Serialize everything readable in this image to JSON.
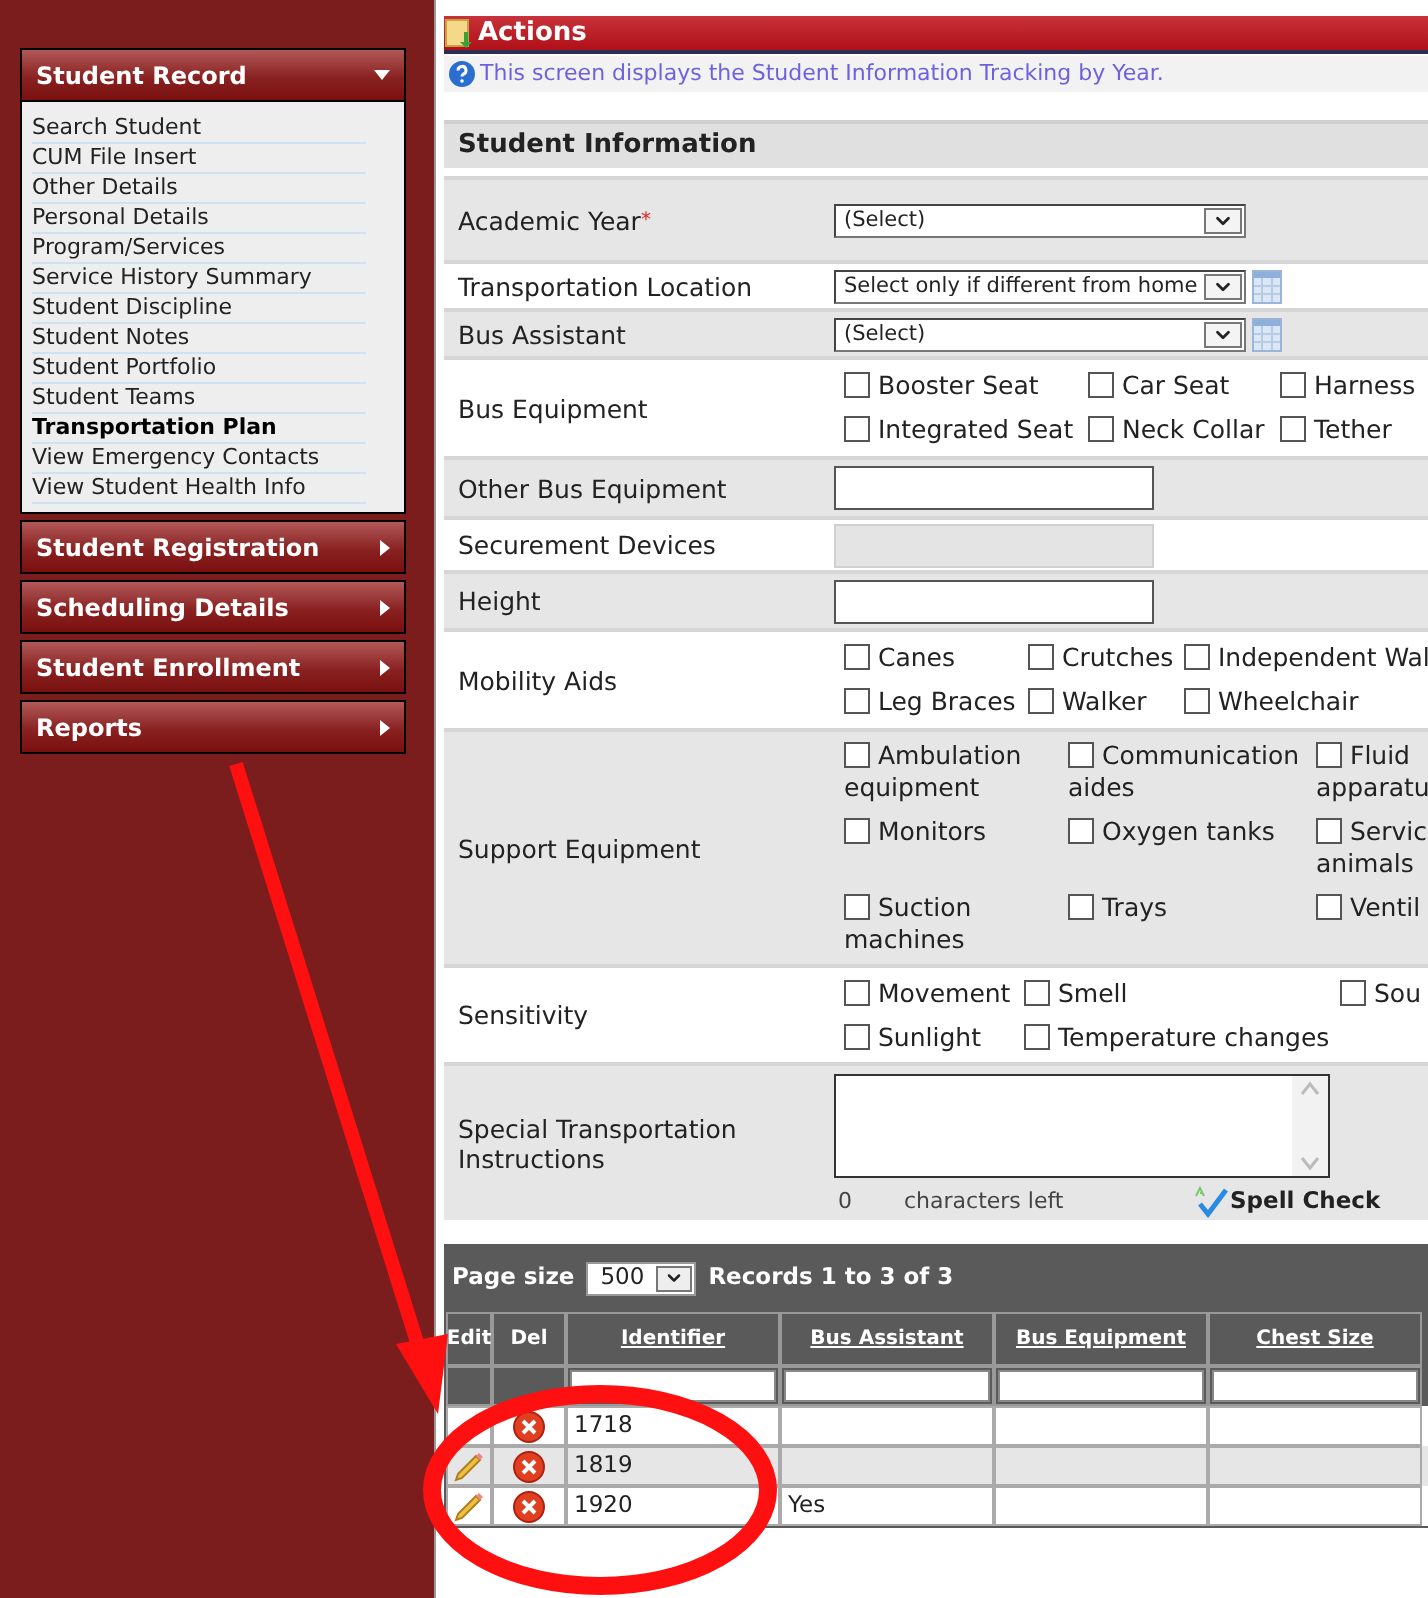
{
  "sidebar": {
    "sections": [
      {
        "title": "Student Record",
        "expanded": true,
        "items": [
          {
            "label": "Search Student",
            "selected": false
          },
          {
            "label": "CUM File Insert",
            "selected": false
          },
          {
            "label": "Other Details",
            "selected": false
          },
          {
            "label": "Personal Details",
            "selected": false
          },
          {
            "label": "Program/Services",
            "selected": false
          },
          {
            "label": "Service History Summary",
            "selected": false
          },
          {
            "label": "Student Discipline",
            "selected": false
          },
          {
            "label": "Student Notes",
            "selected": false
          },
          {
            "label": "Student Portfolio",
            "selected": false
          },
          {
            "label": "Student Teams",
            "selected": false
          },
          {
            "label": "Transportation Plan",
            "selected": true
          },
          {
            "label": "View Emergency Contacts",
            "selected": false
          },
          {
            "label": "View Student Health Info",
            "selected": false
          }
        ]
      },
      {
        "title": "Student Registration",
        "expanded": false
      },
      {
        "title": "Scheduling Details",
        "expanded": false
      },
      {
        "title": "Student Enrollment",
        "expanded": false
      },
      {
        "title": "Reports",
        "expanded": false
      }
    ]
  },
  "actions": {
    "title": "Actions",
    "help_text": "This screen displays the Student Information Tracking by Year."
  },
  "form": {
    "title": "Student Information",
    "rows": [
      {
        "label": "Academic Year",
        "required_mark": "*",
        "kind": "select",
        "value": "(Select)"
      },
      {
        "label": "Transportation Location",
        "kind": "select",
        "value": "Select only if different from home",
        "lookup": true
      },
      {
        "label": "Bus Assistant",
        "kind": "select",
        "value": "(Select)",
        "lookup": true
      },
      {
        "label": "Bus Equipment",
        "kind": "checkboxes",
        "options": [
          {
            "label": "Booster Seat",
            "checked": false
          },
          {
            "label": "Car Seat",
            "checked": false
          },
          {
            "label": "Harness",
            "checked": false
          },
          {
            "label": "Integrated Seat",
            "checked": false
          },
          {
            "label": "Neck Collar",
            "checked": false
          },
          {
            "label": "Tether",
            "checked": false
          }
        ]
      },
      {
        "label": "Other Bus Equipment",
        "kind": "text",
        "disabled": false
      },
      {
        "label": "Securement Devices",
        "kind": "text",
        "disabled": true
      },
      {
        "label": "Height",
        "kind": "text",
        "disabled": false
      },
      {
        "label": "Mobility Aids",
        "kind": "checkboxes",
        "options": [
          {
            "label": "Canes",
            "checked": false
          },
          {
            "label": "Crutches",
            "checked": false
          },
          {
            "label": "Independent Wal",
            "checked": false
          },
          {
            "label": "Leg Braces",
            "checked": false
          },
          {
            "label": "Walker",
            "checked": false
          },
          {
            "label": "Wheelchair",
            "checked": false
          }
        ]
      },
      {
        "label": "Support Equipment",
        "kind": "checkboxes",
        "options": [
          {
            "label": "Ambulation equipment",
            "checked": false
          },
          {
            "label": "Communication aides",
            "checked": false
          },
          {
            "label": "Fluid apparatu",
            "checked": false
          },
          {
            "label": "Monitors",
            "checked": false
          },
          {
            "label": "Oxygen tanks",
            "checked": false
          },
          {
            "label": "Servic animals",
            "checked": false
          },
          {
            "label": "Suction machines",
            "checked": false
          },
          {
            "label": "Trays",
            "checked": false
          },
          {
            "label": "Ventil",
            "checked": false
          }
        ]
      },
      {
        "label": "Sensitivity",
        "kind": "checkboxes",
        "options": [
          {
            "label": "Movement",
            "checked": false
          },
          {
            "label": "Smell",
            "checked": false
          },
          {
            "label": "Sou",
            "checked": false
          },
          {
            "label": "Sunlight",
            "checked": false
          },
          {
            "label": "Temperature changes",
            "checked": false
          }
        ]
      },
      {
        "label": "Special Transportation Instructions",
        "kind": "textarea",
        "count": "0",
        "count_label": "characters left",
        "spell_check": "Spell Check"
      }
    ]
  },
  "grid": {
    "page_size_label": "Page size",
    "page_size": "500",
    "records": "Records 1 to 3 of 3",
    "columns": [
      {
        "label": "Edit",
        "sortable": false,
        "filter": false
      },
      {
        "label": "Del",
        "sortable": false,
        "filter": false
      },
      {
        "label": "Identifier",
        "sortable": true,
        "filter": true
      },
      {
        "label": "Bus Assistant",
        "sortable": true,
        "filter": true
      },
      {
        "label": "Bus Equipment",
        "sortable": true,
        "filter": true
      },
      {
        "label": "Chest Size",
        "sortable": true,
        "filter": true
      }
    ],
    "rows": [
      {
        "identifier": "1718"
      },
      {
        "identifier": "1819"
      },
      {
        "identifier": "1920",
        "bus_assistant": "Yes"
      }
    ]
  }
}
